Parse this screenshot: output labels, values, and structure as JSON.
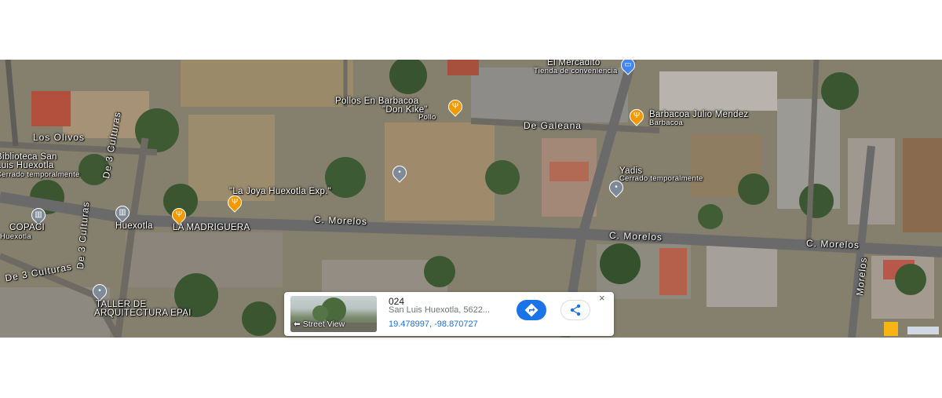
{
  "labels": {
    "el_mercadito": "El Mercadito",
    "tienda": "Tienda de conveniencia",
    "pollos": "Pollos En Barbacoa",
    "don_kike": "\"Don Kike\"",
    "pollo": "Pollo",
    "de_galeana": "De Galeana",
    "barbacoa_julio": "Barbacoa Julio Mendez",
    "barbacoa": "Barbacoa",
    "los_olivos": "Los Olivos",
    "biblioteca": "Biblioteca San",
    "luis_huexotla": "Luis Huexotla",
    "cerrado_temp": "Cerrado temporalmente",
    "yadis": "Yadis",
    "yadis_cerrado": "Cerrado temporalmente",
    "la_joya": "\"La Joya Huexotla Exp.\"",
    "c_morelos_1": "C. Morelos",
    "c_morelos_2": "C. Morelos",
    "c_morelos_3": "C. Morelos",
    "copaci": "COPACI",
    "copaci_sub": "Huexotla",
    "huexotla": "Huexotla",
    "la_madrigueira": "LA MADRIGUERA",
    "de_3_culturas_1": "De 3 Culturas",
    "de_3_culturas_2": "De 3 Culturas",
    "de_3_culturas_3": "De 3 Culturas",
    "taller": "TALLER DE",
    "arquitectura": "ARQUITECTURA EPAI",
    "morelos_v": "Morelos"
  },
  "card": {
    "street_view": "Street View",
    "title": "024",
    "address": "San Luis Huexotla, 5622...",
    "coords": "19.478997, -98.870727",
    "close": "×"
  },
  "icons": {
    "restaurant": "restaurant-pin-icon",
    "store": "store-pin-icon",
    "landmark": "landmark-pin-icon",
    "directions": "directions-icon",
    "share": "share-icon",
    "pegman": "pegman-icon"
  },
  "colors": {
    "restaurant_pin": "#f29900",
    "store_pin": "#4285f4",
    "landmark_pin": "#7e8a97",
    "link_blue": "#1a73e8"
  }
}
